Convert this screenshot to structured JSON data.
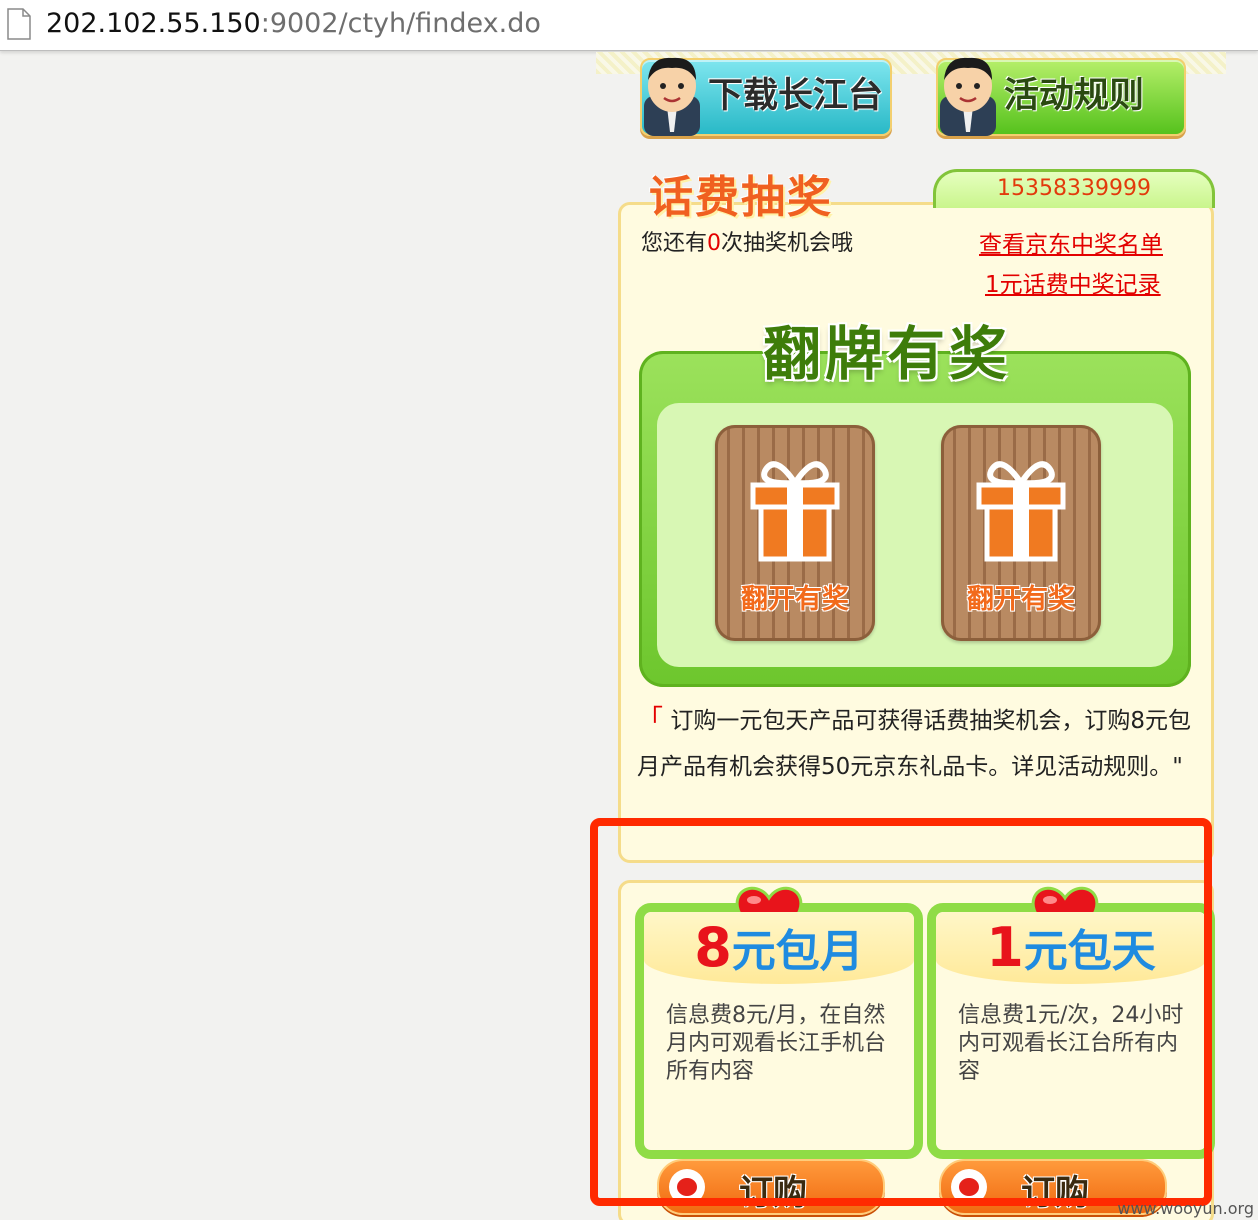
{
  "browser": {
    "url_host": "202.102.55.150",
    "url_rest": ":9002/ctyh/findex.do",
    "icon": "page-icon"
  },
  "top_buttons": {
    "download_label": "下载长江台",
    "rules_label": "活动规则"
  },
  "lottery": {
    "title": "话费抽奖",
    "phone": "15358339999",
    "chance_prefix": "您还有",
    "chance_count": "0",
    "chance_suffix": "次抽奖机会哦",
    "jd_winners_link": "查看京东中奖名单",
    "fee_record_link": "1元话费中奖记录",
    "flip_title": "翻牌有奖",
    "cards": [
      "翻开有奖",
      "翻开有奖"
    ],
    "quote_mark": "「",
    "description": "订购一元包天产品可获得话费抽奖机会，订购8元包月产品有机会获得50元京东礼品卡。详见活动规则。\""
  },
  "products": [
    {
      "title_num": "8",
      "title_unit": "元包月",
      "desc": "信息费8元/月，在自然月内可观看长江手机台所有内容",
      "order_label": "订购"
    },
    {
      "title_num": "1",
      "title_unit": "元包天",
      "desc": "信息费1元/次，24小时内可观看长江台所有内容",
      "order_label": "订购"
    }
  ],
  "watermark": "www.wooyun.org",
  "colors": {
    "highlight": "#ff2a00",
    "link_red": "#e30000",
    "green": "#8fdc46",
    "orange": "#f06a10"
  }
}
